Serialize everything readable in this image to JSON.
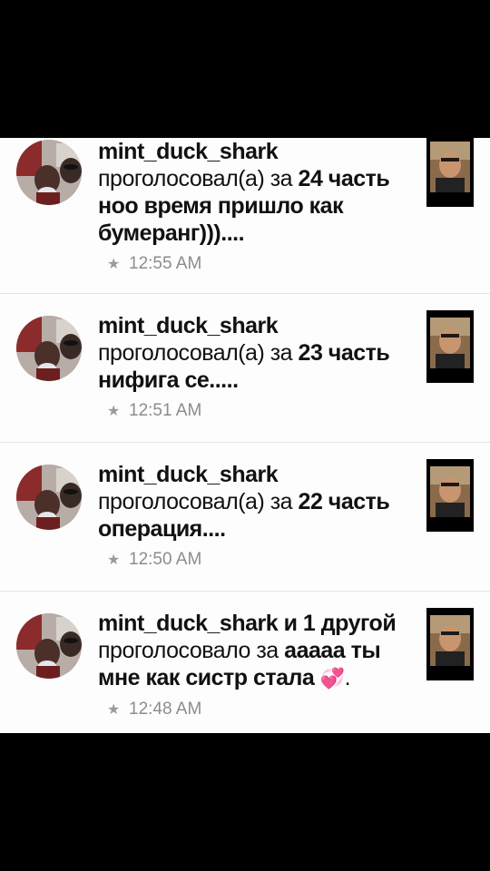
{
  "notifications": [
    {
      "username": "mint_duck_shark",
      "extra": "",
      "verb": "проголосовал(а) за",
      "part": "24 часть",
      "title": "ноо время пришло как бумеранг)))....",
      "time": "12:55 AM",
      "star_icon": "star-icon"
    },
    {
      "username": "mint_duck_shark",
      "extra": "",
      "verb": "проголосовал(а) за",
      "part": "23 часть",
      "title": "нифига се.....",
      "time": "12:51 AM",
      "star_icon": "star-icon"
    },
    {
      "username": "mint_duck_shark",
      "extra": "",
      "verb": "проголосовал(а) за",
      "part": "22 часть",
      "title": "операция....",
      "time": "12:50 AM",
      "star_icon": "star-icon"
    },
    {
      "username": "mint_duck_shark",
      "extra": "и 1 другой",
      "verb": "проголосовало за",
      "part": "ааааа ты",
      "title": "мне как систр стала",
      "title_suffix": ".",
      "emoji": "💞",
      "time": "12:48 AM",
      "star_icon": "star-icon"
    }
  ]
}
